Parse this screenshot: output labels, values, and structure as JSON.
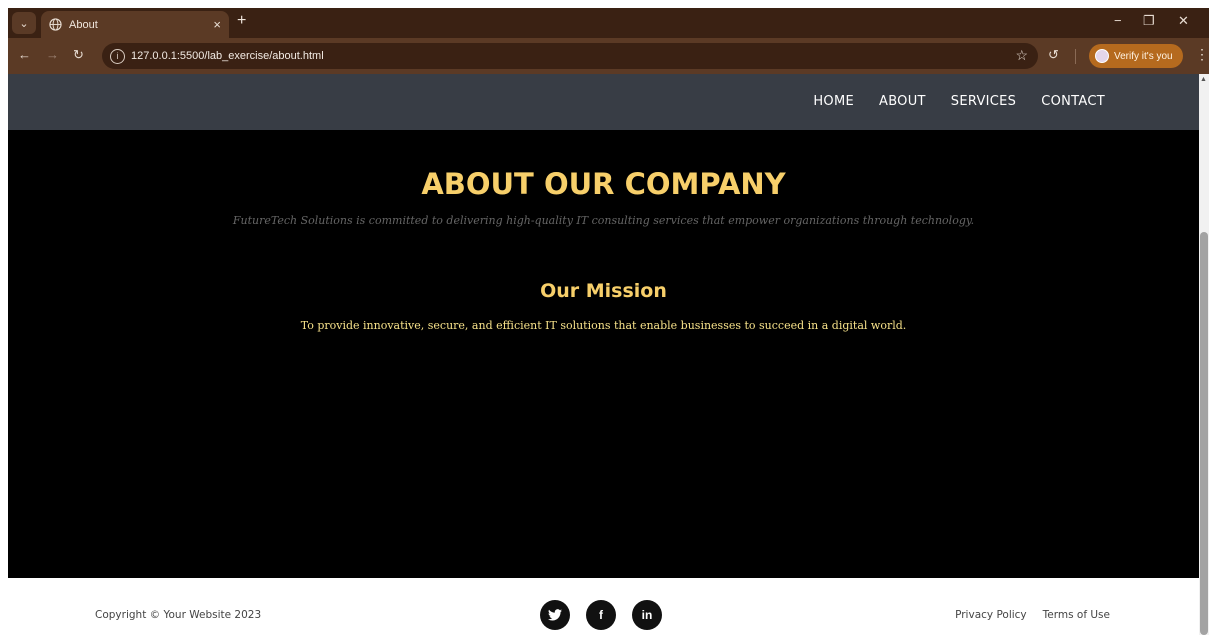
{
  "browser": {
    "tab_title": "About",
    "tab_close": "×",
    "new_tab": "+",
    "url": "127.0.0.1:5500/lab_exercise/about.html",
    "verify_label": "Verify it's you",
    "accent_color": "#b56a1e",
    "chrome_color": "#5b3a25"
  },
  "site": {
    "nav": [
      "HOME",
      "ABOUT",
      "SERVICES",
      "CONTACT"
    ],
    "title": "ABOUT OUR COMPANY",
    "subtitle": "FutureTech Solutions is committed to delivering high-quality IT consulting services that empower organizations through technology.",
    "mission_title": "Our Mission",
    "mission_text": "To provide innovative, secure, and efficient IT solutions that enable businesses to succeed in a digital world.",
    "accent_color": "#f7cf6a",
    "header_color": "#383d45"
  },
  "footer": {
    "copyright": "Copyright © Your Website 2023",
    "social": [
      "twitter-icon",
      "facebook-icon",
      "linkedin-icon"
    ],
    "links": [
      "Privacy Policy",
      "Terms of Use"
    ]
  }
}
